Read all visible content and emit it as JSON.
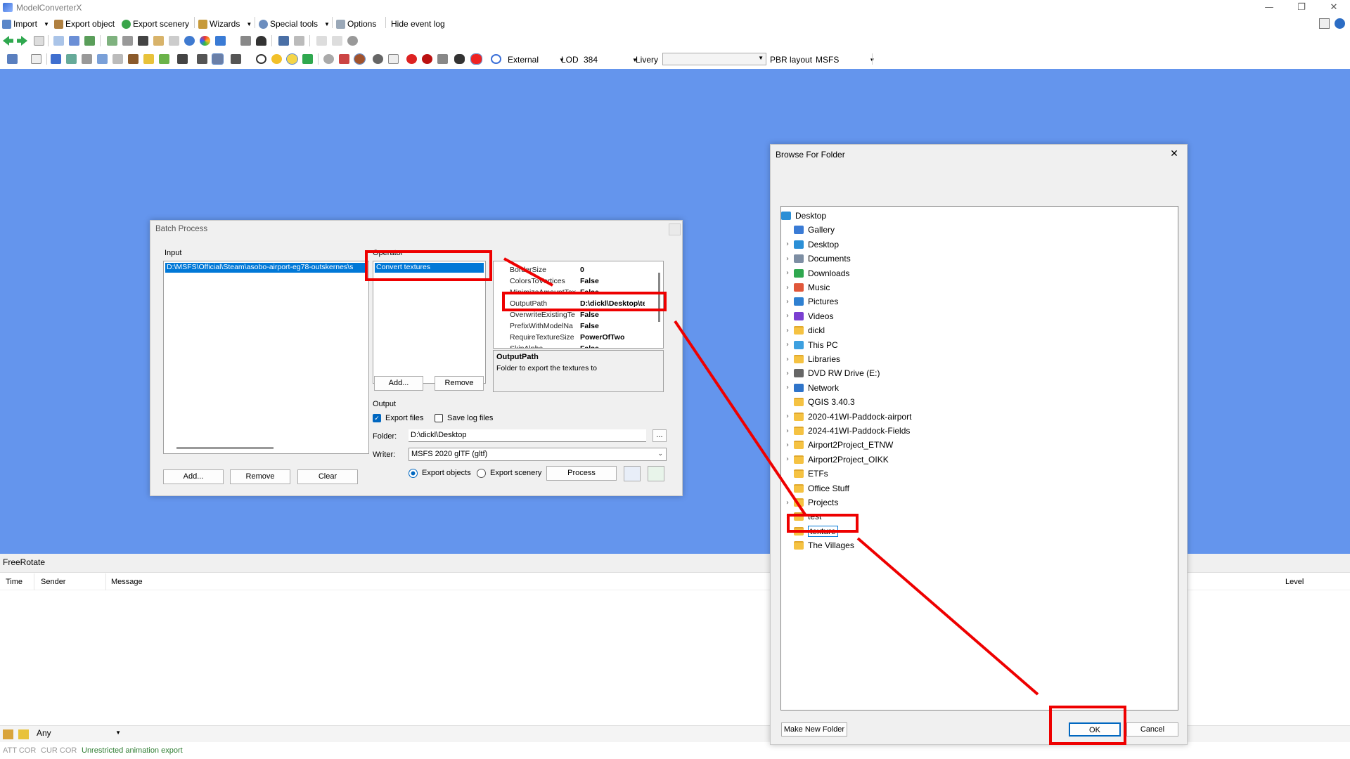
{
  "app": {
    "title": "ModelConverterX"
  },
  "menu": {
    "import": "Import",
    "export_object": "Export object",
    "export_scenery": "Export scenery",
    "wizards": "Wizards",
    "special_tools": "Special tools",
    "options": "Options",
    "hide_event_log": "Hide event log"
  },
  "toolbar3": {
    "external": "External",
    "lod_label": "LOD",
    "lod_value": "384",
    "livery_label": "Livery",
    "livery_value": "",
    "pbr_label": "PBR layout",
    "pbr_value": "MSFS"
  },
  "batch": {
    "title": "Batch Process",
    "input_label": "Input",
    "input_item": "D:\\MSFS\\Official\\Steam\\asobo-airport-eg78-outskernes\\s",
    "add": "Add...",
    "remove": "Remove",
    "clear": "Clear",
    "operator_label": "Operator",
    "operator_item": "Convert textures",
    "op_add": "Add...",
    "op_remove": "Remove",
    "properties": [
      {
        "key": "BorderSize",
        "value": "0"
      },
      {
        "key": "ColorsToVertices",
        "value": "False"
      },
      {
        "key": "MinimizeAmountTex",
        "value": "False"
      },
      {
        "key": "OutputPath",
        "value": "D:\\dickl\\Desktop\\te"
      },
      {
        "key": "OverwriteExistingTe",
        "value": "False"
      },
      {
        "key": "PrefixWithModelNa",
        "value": "False"
      },
      {
        "key": "RequireTextureSize",
        "value": "PowerOfTwo"
      },
      {
        "key": "SkipAlpha",
        "value": "False"
      }
    ],
    "desc_title": "OutputPath",
    "desc_text": "Folder to export the textures to",
    "output_label": "Output",
    "export_files": "Export files",
    "export_files_checked": true,
    "save_log_files": "Save log files",
    "folder_label": "Folder:",
    "folder_value": "D:\\dickl\\Desktop",
    "browse": "...",
    "writer_label": "Writer:",
    "writer_value": "MSFS 2020 glTF (gltf)",
    "export_objects": "Export objects",
    "export_scenery": "Export scenery",
    "process": "Process"
  },
  "browse": {
    "title": "Browse For Folder",
    "close": "✕",
    "make_new_folder": "Make New Folder",
    "ok": "OK",
    "cancel": "Cancel",
    "tree": [
      {
        "label": "Desktop",
        "icon": "desktop-icon",
        "expandable": false,
        "indent": 0
      },
      {
        "label": "Gallery",
        "icon": "gallery-icon",
        "expandable": false,
        "indent": 1
      },
      {
        "label": "Desktop",
        "icon": "desktop-icon",
        "expandable": true,
        "indent": 1
      },
      {
        "label": "Documents",
        "icon": "documents-icon",
        "expandable": true,
        "indent": 1
      },
      {
        "label": "Downloads",
        "icon": "download-icon",
        "expandable": true,
        "indent": 1
      },
      {
        "label": "Music",
        "icon": "music-icon",
        "expandable": true,
        "indent": 1
      },
      {
        "label": "Pictures",
        "icon": "pictures-icon",
        "expandable": true,
        "indent": 1
      },
      {
        "label": "Videos",
        "icon": "videos-icon",
        "expandable": true,
        "indent": 1
      },
      {
        "label": "dickl",
        "icon": "folder-icon",
        "expandable": true,
        "indent": 1
      },
      {
        "label": "This PC",
        "icon": "pc-icon",
        "expandable": true,
        "indent": 1
      },
      {
        "label": "Libraries",
        "icon": "folder-icon",
        "expandable": true,
        "indent": 1
      },
      {
        "label": "DVD RW Drive (E:)",
        "icon": "dvd-drive-icon",
        "expandable": true,
        "indent": 1
      },
      {
        "label": "Network",
        "icon": "network-icon",
        "expandable": true,
        "indent": 1
      },
      {
        "label": "QGIS 3.40.3",
        "icon": "folder-icon",
        "expandable": false,
        "indent": 1
      },
      {
        "label": "2020-41WI-Paddock-airport",
        "icon": "folder-icon",
        "expandable": true,
        "indent": 1
      },
      {
        "label": "2024-41WI-Paddock-Fields",
        "icon": "folder-icon",
        "expandable": true,
        "indent": 1
      },
      {
        "label": "Airport2Project_ETNW",
        "icon": "folder-icon",
        "expandable": true,
        "indent": 1
      },
      {
        "label": "Airport2Project_OIKK",
        "icon": "folder-icon",
        "expandable": true,
        "indent": 1
      },
      {
        "label": "ETFs",
        "icon": "folder-icon",
        "expandable": false,
        "indent": 1
      },
      {
        "label": "Office Stuff",
        "icon": "folder-icon",
        "expandable": false,
        "indent": 1
      },
      {
        "label": "Projects",
        "icon": "folder-icon",
        "expandable": true,
        "indent": 1
      },
      {
        "label": "test",
        "icon": "folder-icon",
        "expandable": true,
        "indent": 1
      },
      {
        "label": "texture",
        "icon": "folder-icon",
        "expandable": false,
        "indent": 1,
        "selected": true
      },
      {
        "label": "The Villages",
        "icon": "folder-icon",
        "expandable": false,
        "indent": 1
      }
    ]
  },
  "log": {
    "panel_title": "FreeRotate",
    "col_time": "Time",
    "col_sender": "Sender",
    "col_message": "Message",
    "col_level": "Level",
    "filter_value": "Any"
  },
  "status": {
    "att": "ATT COR",
    "cur": "CUR COR",
    "message": "Unrestricted animation export"
  },
  "colors": {
    "workspace": "#6495ed",
    "highlight": "#ee0000",
    "selection": "#0078d7",
    "status_green": "#2e7d32"
  }
}
